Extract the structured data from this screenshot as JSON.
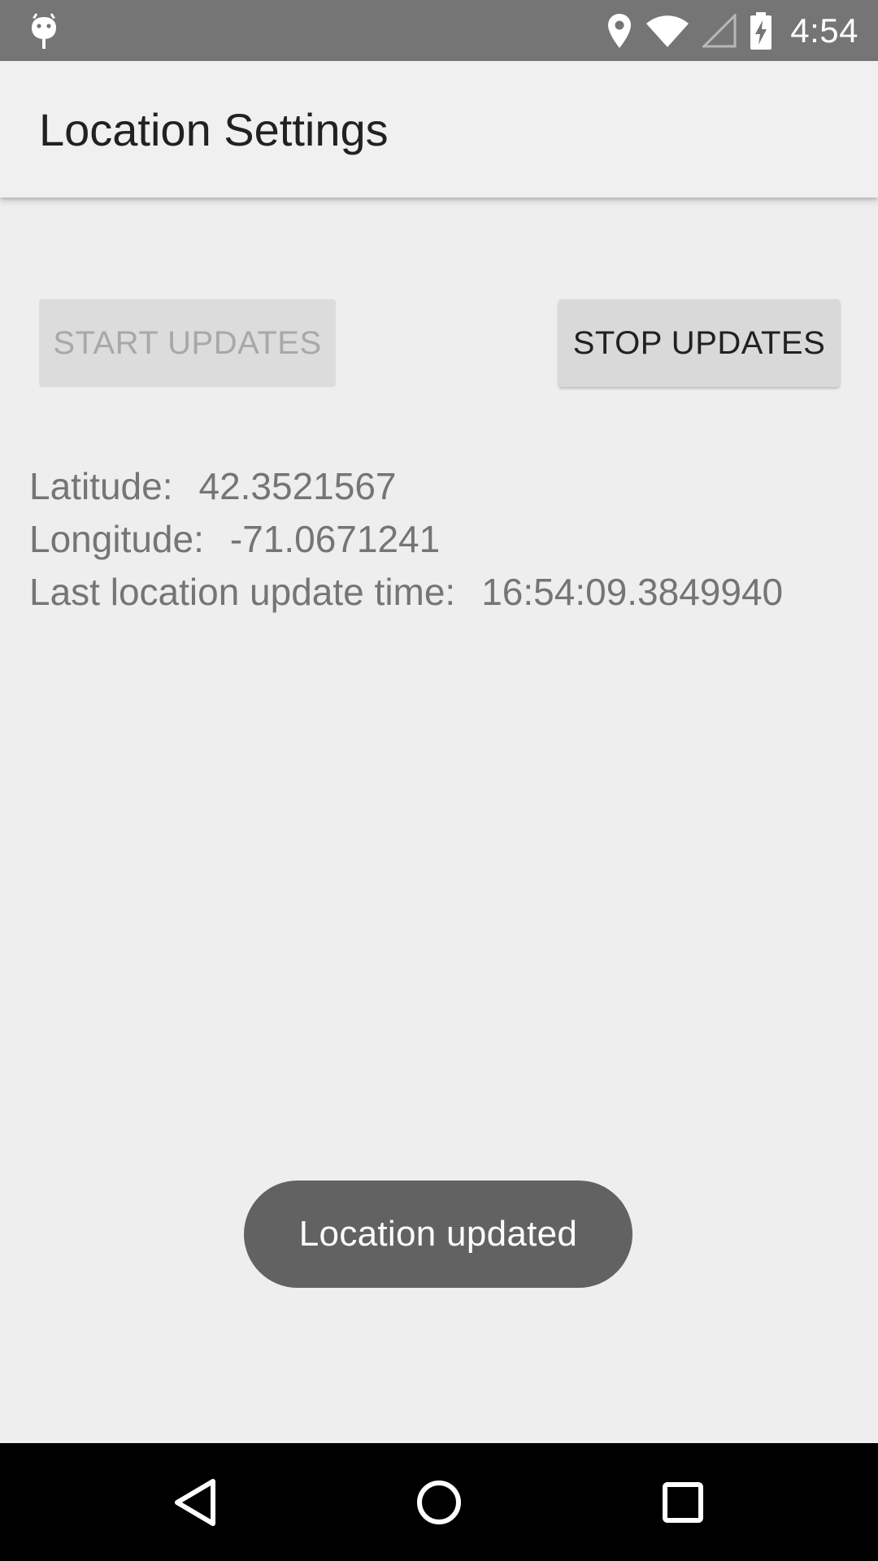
{
  "status_bar": {
    "time": "4:54",
    "background": "#757575",
    "icons": [
      "android-debug-icon",
      "location-pin-icon",
      "wifi-icon",
      "cell-signal-icon",
      "battery-charging-icon"
    ]
  },
  "app_bar": {
    "title": "Location Settings"
  },
  "buttons": {
    "start_label": "START UPDATES",
    "start_enabled": false,
    "stop_label": "STOP UPDATES",
    "stop_enabled": true
  },
  "location": {
    "latitude_label": "Latitude:",
    "latitude_value": "42.3521567",
    "longitude_label": "Longitude:",
    "longitude_value": "-71.0671241",
    "update_time_label": "Last location update time:",
    "update_time_value": "16:54:09.3849940"
  },
  "toast": {
    "message": "Location updated"
  },
  "nav_bar": {
    "icons": [
      "back-icon",
      "home-icon",
      "recents-icon"
    ]
  },
  "colors": {
    "background": "#eeeeee",
    "toast": "#626262",
    "nav_bar": "#000000"
  }
}
